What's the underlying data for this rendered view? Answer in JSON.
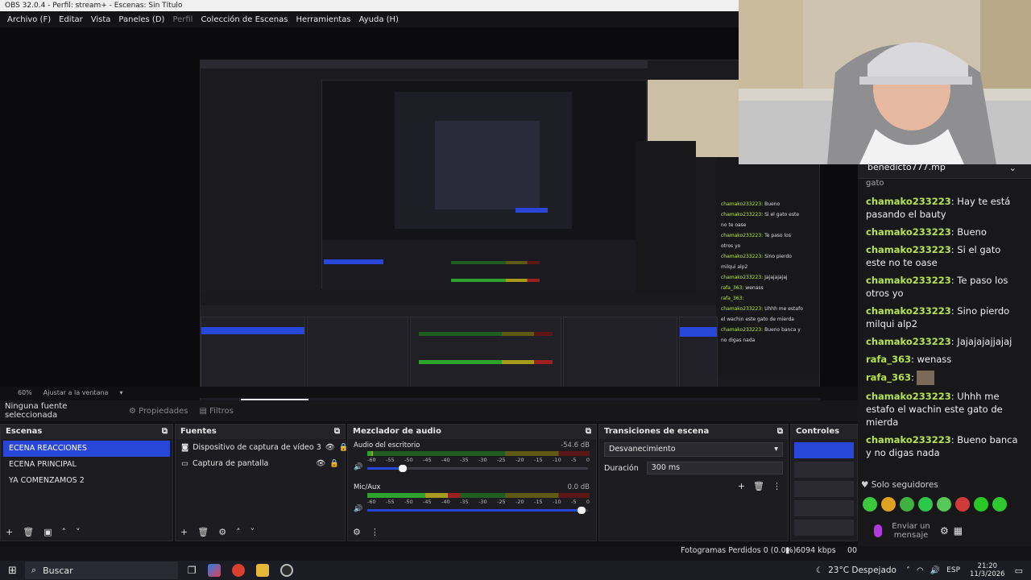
{
  "window": {
    "title": "OBS 32.0.4 - Perfil: stream+ - Escenas: Sin Título"
  },
  "menu": [
    {
      "label": "Archivo (F)",
      "dim": false
    },
    {
      "label": "Editar",
      "dim": false
    },
    {
      "label": "Vista",
      "dim": false
    },
    {
      "label": "Paneles (D)",
      "dim": false
    },
    {
      "label": "Perfil",
      "dim": true
    },
    {
      "label": "Colección de Escenas",
      "dim": false
    },
    {
      "label": "Herramientas",
      "dim": false
    },
    {
      "label": "Ayuda (H)",
      "dim": false
    }
  ],
  "zoom": {
    "level": "60%",
    "fit_label": "Ajustar a la ventana"
  },
  "properties_bar": {
    "no_source": "Ninguna fuente seleccionada",
    "properties_label": "Propiedades",
    "filters_label": "Filtros"
  },
  "scenes": {
    "title": "Escenas",
    "items": [
      "ECENA REACCIONES",
      "ECENA PRINCIPAL",
      "YA COMENZAMOS 2"
    ],
    "selected": 0
  },
  "sources": {
    "title": "Fuentes",
    "items": [
      {
        "label": "Dispositivo de captura de vídeo 3",
        "icon": "camera-icon"
      },
      {
        "label": "Captura de pantalla",
        "icon": "monitor-icon"
      }
    ]
  },
  "mixer": {
    "title": "Mezclador de audio",
    "channels": [
      {
        "name": "Audio del escritorio",
        "db": "-54.6 dB",
        "level": 0.03,
        "volume": 0.16
      },
      {
        "name": "Mic/Aux",
        "db": "0.0 dB",
        "level": 0.42,
        "volume": 0.97
      }
    ],
    "ticks": [
      "-60",
      "-55",
      "-50",
      "-45",
      "-40",
      "-35",
      "-30",
      "-25",
      "-20",
      "-15",
      "-10",
      "-5",
      "0"
    ]
  },
  "transitions": {
    "title": "Transiciones de escena",
    "selected": "Desvanecimiento",
    "duration_label": "Duración",
    "duration_value": "300 ms"
  },
  "controls": {
    "title": "Controles"
  },
  "status": {
    "dropped": "Fotogramas Perdidos 0 (0.0%)",
    "bitrate": "6094 kbps",
    "time_partial": "00"
  },
  "chat": {
    "dropdown_user": "benedicto777.mp",
    "partial_top": "gato",
    "messages": [
      {
        "user": "chamako233223",
        "text": "Hay te está pasando el bauty"
      },
      {
        "user": "chamako233223",
        "text": "Bueno"
      },
      {
        "user": "chamako233223",
        "text": "Si el gato este no te oase"
      },
      {
        "user": "chamako233223",
        "text": "Te paso los otros yo"
      },
      {
        "user": "chamako233223",
        "text": "Sino pierdo milqui alp2"
      },
      {
        "user": "chamako233223",
        "text": "Jajajajajjajaj"
      },
      {
        "user": "rafa_363",
        "text": "wenass"
      },
      {
        "user": "rafa_363",
        "text": ""
      },
      {
        "user": "chamako233223",
        "text": "Uhhh me estafo el wachin este gato de mierda"
      },
      {
        "user": "chamako233223",
        "text": "Bueno banca y no digas nada"
      }
    ],
    "followers_only": "Solo seguidores",
    "send_placeholder": "Enviar un mensaje",
    "emote_colors": [
      "#3cc83c",
      "#e0a020",
      "#40b040",
      "#2cc84a",
      "#58c858",
      "#d23a3a",
      "#28c828",
      "#30c830"
    ]
  },
  "taskbar": {
    "search_placeholder": "Buscar",
    "weather": "23°C  Despejado",
    "lang": "ESP",
    "time": "21:20",
    "date": "11/3/2026"
  },
  "colors": {
    "selection": "#2846d8",
    "chat_username": "#b6e34a"
  }
}
